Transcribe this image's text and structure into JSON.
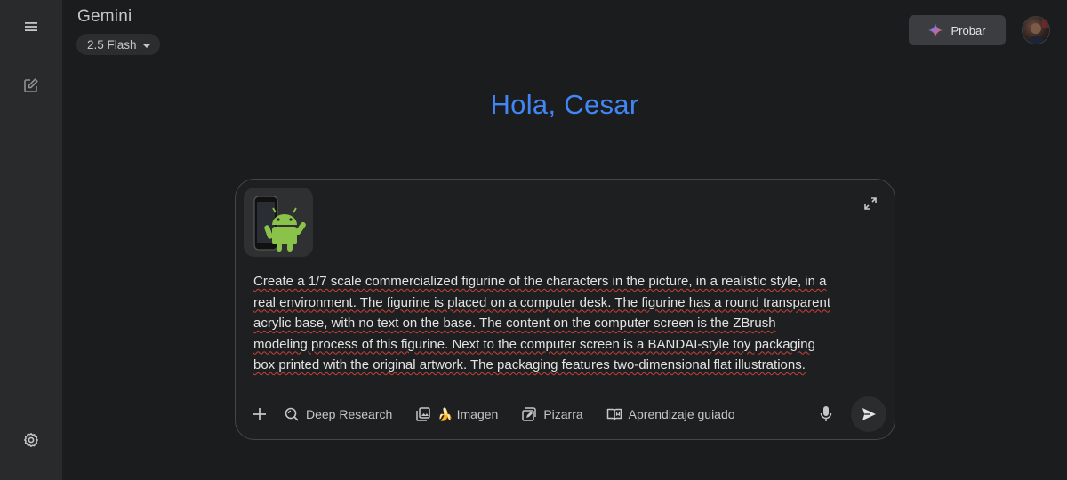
{
  "app": {
    "title": "Gemini"
  },
  "model": {
    "selected": "2.5 Flash"
  },
  "header": {
    "try_label": "Probar"
  },
  "greeting": "Hola, Cesar",
  "prompt": {
    "lines": [
      "Create a 1/7 scale commercialized figurine of the characters in the picture, in a realistic style, in a",
      "real environment. The figurine is placed on a computer desk. The figurine has a round transparent",
      "acrylic base, with no text on the base. The content on the computer screen is the ZBrush",
      "modeling process of this figurine. Next to the computer screen is a BANDAI-style toy packaging",
      "box printed with the original artwork. The packaging features two-dimensional flat illustrations."
    ]
  },
  "tools": {
    "deep_research": "Deep Research",
    "image": "🍌 Imagen",
    "canvas": "Pizarra",
    "guided_learning": "Aprendizaje guiado"
  },
  "icons": {
    "sidebar": [
      "menu-icon",
      "new-chat-icon",
      "settings-icon"
    ],
    "toolbar": [
      "plus-icon",
      "deep-research-icon",
      "image-icon",
      "canvas-icon",
      "guided-learning-icon",
      "mic-icon",
      "send-icon"
    ]
  },
  "colors": {
    "accent": "#4285f4",
    "background": "#1b1c1d",
    "sidebar": "#282a2c",
    "spellcheck": "#c8413a"
  }
}
